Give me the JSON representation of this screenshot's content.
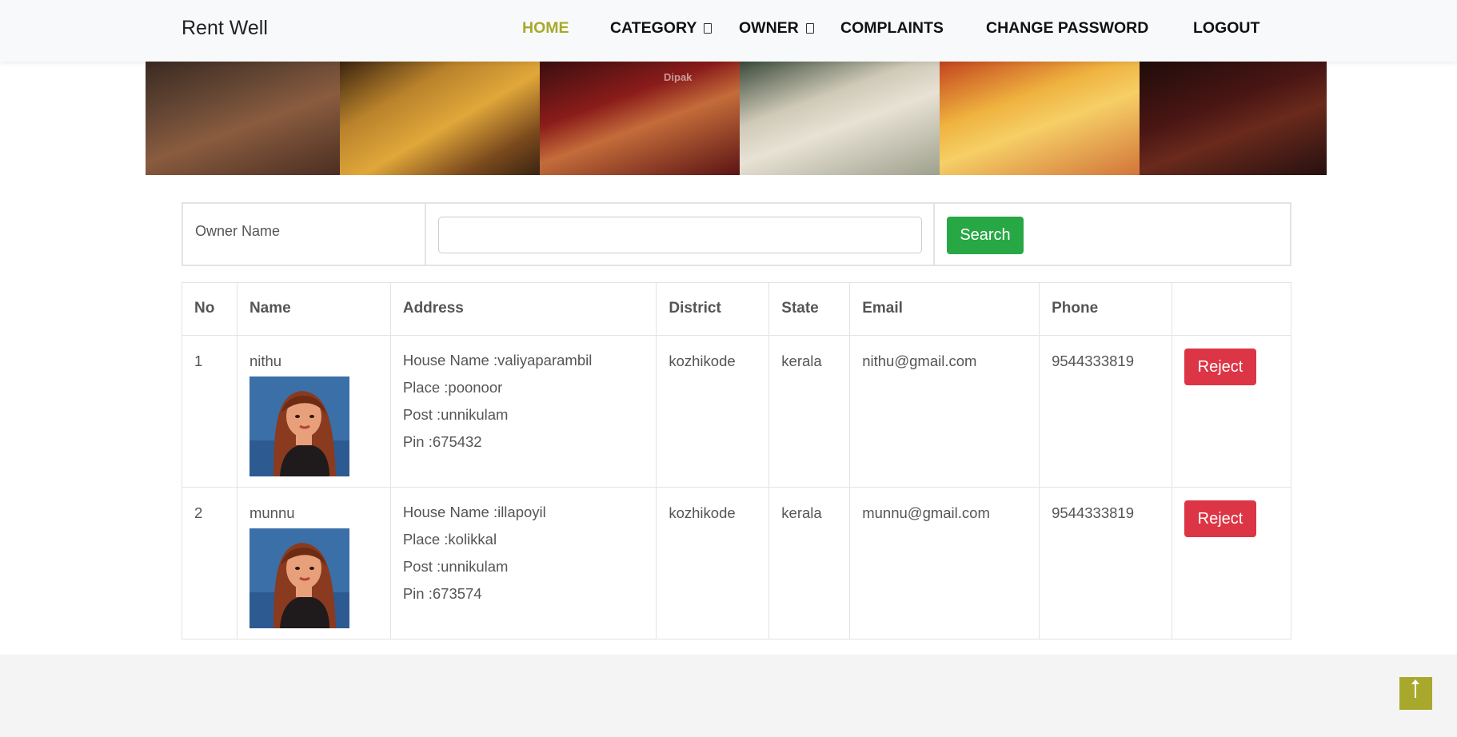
{
  "navbar": {
    "brand": "Rent Well",
    "items": [
      {
        "label": "HOME",
        "active": true
      },
      {
        "label": "CATEGORY",
        "dropdown": true
      },
      {
        "label": "OWNER",
        "dropdown": true
      },
      {
        "label": "COMPLAINTS"
      },
      {
        "label": "CHANGE PASSWORD"
      },
      {
        "label": "LOGOUT"
      }
    ],
    "active_color": "#a8a92c"
  },
  "banner": {
    "watermark": "Dipak"
  },
  "search": {
    "label": "Owner Name",
    "input_value": "",
    "button_label": "Search"
  },
  "table": {
    "headers": [
      "No",
      "Name",
      "Address",
      "District",
      "State",
      "Email",
      "Phone",
      ""
    ],
    "rows": [
      {
        "no": "1",
        "name": "nithu",
        "address": {
          "house": "House Name :valiyaparambil",
          "place": "Place :poonoor",
          "post": "Post :unnikulam",
          "pin": "Pin :675432"
        },
        "district": "kozhikode",
        "state": "kerala",
        "email": "nithu@gmail.com",
        "phone": "9544333819",
        "action": "Reject"
      },
      {
        "no": "2",
        "name": "munnu",
        "address": {
          "house": "House Name :illapoyil",
          "place": "Place :kolikkal",
          "post": "Post :unnikulam",
          "pin": "Pin :673574"
        },
        "district": "kozhikode",
        "state": "kerala",
        "email": "munnu@gmail.com",
        "phone": "9544333819",
        "action": "Reject"
      }
    ]
  },
  "colors": {
    "search_button": "#28a745",
    "reject_button": "#dc3545",
    "back_to_top": "#a8a92c"
  }
}
